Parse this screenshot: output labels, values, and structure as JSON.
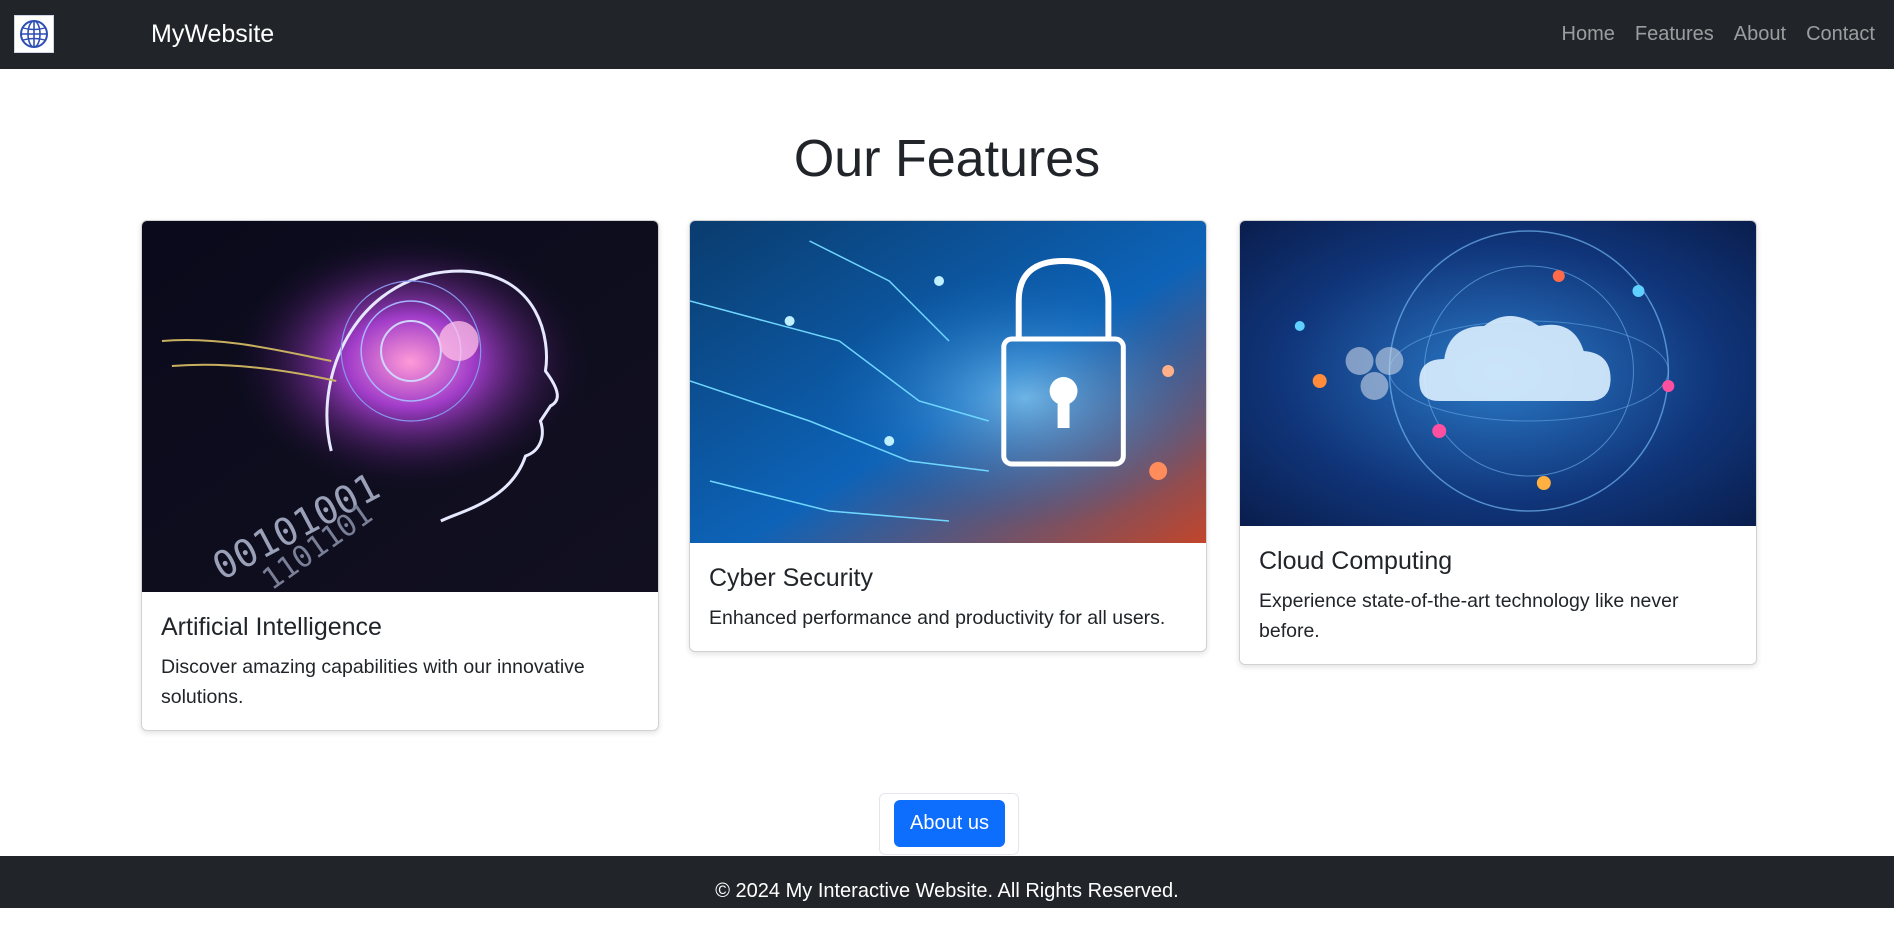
{
  "navbar": {
    "logo_icon": "globe-icon",
    "brand": "MyWebsite",
    "links": [
      "Home",
      "Features",
      "About",
      "Contact"
    ]
  },
  "main": {
    "title": "Our Features",
    "cards": [
      {
        "image_icon": "ai-head-image",
        "title": "Artificial Intelligence",
        "text": "Discover amazing capabilities with our innovative solutions."
      },
      {
        "image_icon": "security-lock-image",
        "title": "Cyber Security",
        "text": "Enhanced performance and productivity for all users."
      },
      {
        "image_icon": "cloud-globe-image",
        "title": "Cloud Computing",
        "text": "Experience state-of-the-art technology like never before."
      }
    ],
    "button_label": "About us"
  },
  "footer": {
    "text": "© 2024 My Interactive Website. All Rights Reserved."
  },
  "colors": {
    "navbar_bg": "#212529",
    "primary": "#0d6efd",
    "text": "#212529"
  }
}
